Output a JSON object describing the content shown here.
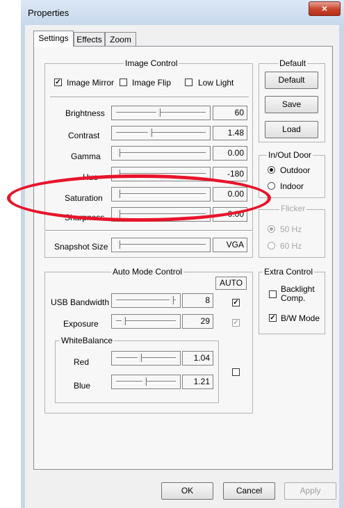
{
  "window": {
    "title": "Properties",
    "close_glyph": "×"
  },
  "tabs": [
    {
      "label": "Settings",
      "active": true
    },
    {
      "label": "Effects",
      "active": false
    },
    {
      "label": "Zoom",
      "active": false
    }
  ],
  "image_control": {
    "title": "Image Control",
    "checkboxes": [
      {
        "label": "Image Mirror",
        "checked": true
      },
      {
        "label": "Image Flip",
        "checked": false
      },
      {
        "label": "Low Light",
        "checked": false
      }
    ],
    "sliders": [
      {
        "label": "Brightness",
        "value": "60",
        "level": 0.46
      },
      {
        "label": "Contrast",
        "value": "1.48",
        "level": 0.37
      },
      {
        "label": "Gamma",
        "value": "0.00",
        "level": 0.0
      },
      {
        "label": "Hue",
        "value": "-180",
        "level": 0.0
      },
      {
        "label": "Saturation",
        "value": "0.00",
        "level": 0.0
      },
      {
        "label": "Sharpness",
        "value": "0.00",
        "level": 0.0
      }
    ],
    "snapshot": {
      "label": "Snapshot Size",
      "value": "VGA",
      "level": 0.0
    }
  },
  "default_group": {
    "title": "Default",
    "buttons": [
      "Default",
      "Save",
      "Load"
    ]
  },
  "inout": {
    "title": "In/Out Door",
    "options": [
      {
        "label": "Outdoor",
        "selected": true
      },
      {
        "label": "Indoor",
        "selected": false
      }
    ]
  },
  "flicker": {
    "title": "Flicker",
    "options": [
      {
        "label": "50 Hz",
        "selected": true
      },
      {
        "label": "60 Hz",
        "selected": false
      }
    ]
  },
  "auto_mode": {
    "title": "Auto Mode Control",
    "auto_header": "AUTO",
    "rows": [
      {
        "label": "USB Bandwidth",
        "value": "8",
        "level": 0.94,
        "auto": true,
        "auto_enabled": true
      },
      {
        "label": "Exposure",
        "value": "29",
        "level": 0.1,
        "auto": true,
        "auto_enabled": false
      }
    ],
    "white_balance": {
      "title": "WhiteBalance",
      "rows": [
        {
          "label": "Red",
          "value": "1.04",
          "level": 0.38
        },
        {
          "label": "Blue",
          "value": "1.21",
          "level": 0.46
        }
      ],
      "auto": false
    }
  },
  "extra_control": {
    "title": "Extra Control",
    "items": [
      {
        "label": "Backlight Comp.",
        "checked": false
      },
      {
        "label": "B/W Mode",
        "checked": true
      }
    ]
  },
  "footer": {
    "ok": "OK",
    "cancel": "Cancel",
    "apply": "Apply"
  },
  "annotation": {
    "color": "#e8142a",
    "shape": "ellipse"
  }
}
